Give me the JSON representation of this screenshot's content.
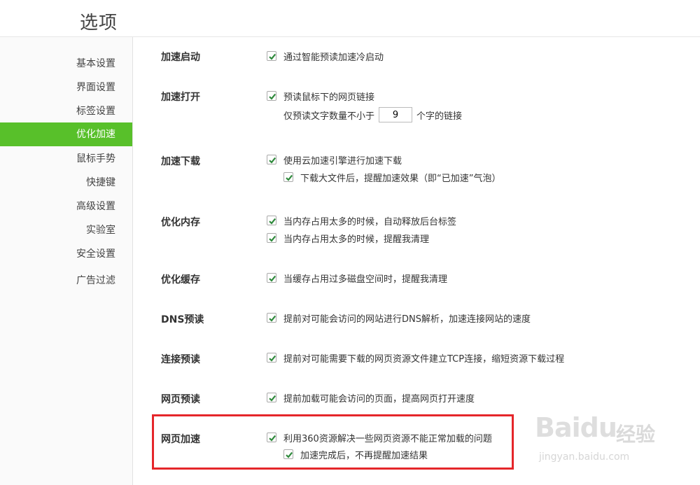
{
  "header": {
    "title": "选项"
  },
  "sidebar": {
    "items": [
      {
        "label": "基本设置",
        "active": false
      },
      {
        "label": "界面设置",
        "active": false
      },
      {
        "label": "标签设置",
        "active": false
      },
      {
        "label": "优化加速",
        "active": true
      },
      {
        "label": "鼠标手势",
        "active": false
      },
      {
        "label": "快捷键",
        "active": false
      },
      {
        "label": "高级设置",
        "active": false
      },
      {
        "label": "实验室",
        "active": false
      },
      {
        "label": "安全设置",
        "active": false
      },
      {
        "label": "广告过滤",
        "active": false
      }
    ]
  },
  "sections": [
    {
      "label": "加速启动",
      "options": [
        {
          "text": "通过智能预读加速冷启动",
          "checked": true
        }
      ]
    },
    {
      "label": "加速打开",
      "options": [
        {
          "text": "预读鼠标下的网页链接",
          "checked": true
        }
      ],
      "prefetch_row": {
        "prefix": "仅预读文字数量不小于",
        "value": "9",
        "suffix": "个字的链接"
      }
    },
    {
      "label": "加速下载",
      "options": [
        {
          "text": "使用云加速引擎进行加速下载",
          "checked": true
        },
        {
          "text": "下载大文件后，提醒加速效果（即“已加速”气泡）",
          "checked": true
        }
      ]
    },
    {
      "label": "优化内存",
      "options": [
        {
          "text": "当内存占用太多的时候，自动释放后台标签",
          "checked": true
        },
        {
          "text": "当内存占用太多的时候，提醒我清理",
          "checked": true
        }
      ]
    },
    {
      "label": "优化缓存",
      "options": [
        {
          "text": "当缓存占用过多磁盘空间时，提醒我清理",
          "checked": true
        }
      ]
    },
    {
      "label": "DNS预读",
      "options": [
        {
          "text": "提前对可能会访问的网站进行DNS解析，加速连接网站的速度",
          "checked": true
        }
      ]
    },
    {
      "label": "连接预读",
      "options": [
        {
          "text": "提前对可能需要下载的网页资源文件建立TCP连接，缩短资源下载过程",
          "checked": true
        }
      ]
    },
    {
      "label": "网页预读",
      "options": [
        {
          "text": "提前加载可能会访问的页面，提高网页打开速度",
          "checked": true
        }
      ]
    },
    {
      "label": "网页加速",
      "options": [
        {
          "text": "利用360资源解决一些网页资源不能正常加载的问题",
          "checked": true
        },
        {
          "text": "加速完成后，不再提醒加速结果",
          "checked": true
        }
      ]
    }
  ],
  "watermark": {
    "brand": "Baidu",
    "cn": "经验",
    "url": "jingyan.baidu.com"
  },
  "colors": {
    "accent": "#58c02a",
    "checkmark": "#2f8a3c",
    "highlight": "#e5262a"
  }
}
